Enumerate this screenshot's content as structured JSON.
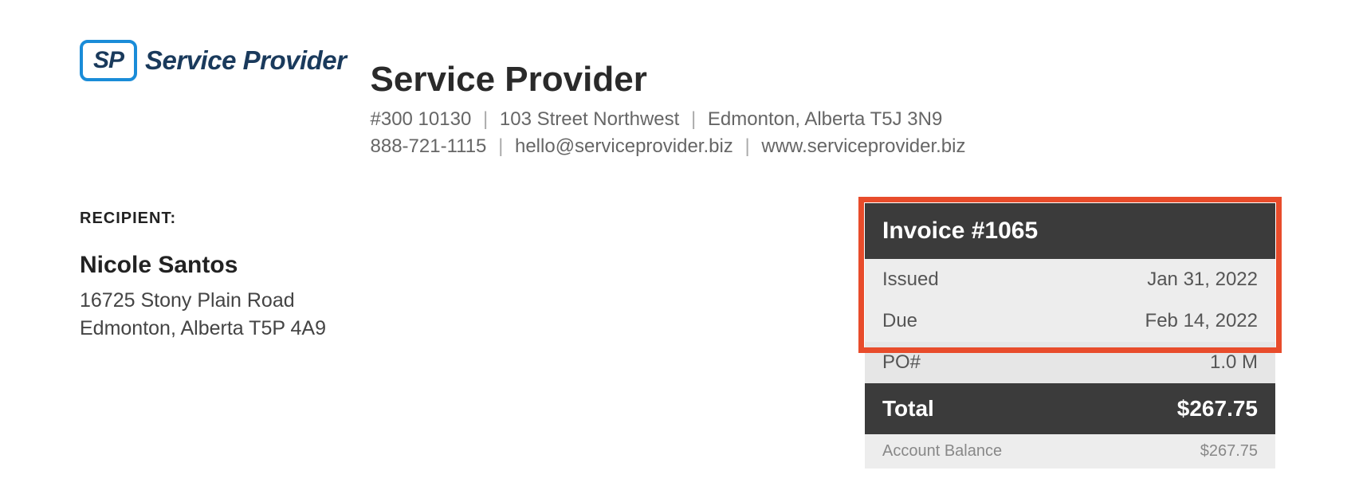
{
  "logo": {
    "badge_text": "SP",
    "name": "Service Provider"
  },
  "company": {
    "name": "Service Provider",
    "address_1": "#300 10130",
    "address_2": "103 Street Northwest",
    "address_3": "Edmonton, Alberta T5J 3N9",
    "phone": "888-721-1115",
    "email": "hello@serviceprovider.biz",
    "website": "www.serviceprovider.biz"
  },
  "recipient": {
    "label": "RECIPIENT:",
    "name": "Nicole Santos",
    "address_line1": "16725 Stony Plain Road",
    "address_line2": "Edmonton, Alberta T5P 4A9"
  },
  "invoice": {
    "title": "Invoice #1065",
    "issued_label": "Issued",
    "issued_value": "Jan 31, 2022",
    "due_label": "Due",
    "due_value": "Feb 14, 2022",
    "po_label": "PO#",
    "po_value": "1.0 M",
    "total_label": "Total",
    "total_value": "$267.75",
    "balance_label": "Account Balance",
    "balance_value": "$267.75"
  }
}
